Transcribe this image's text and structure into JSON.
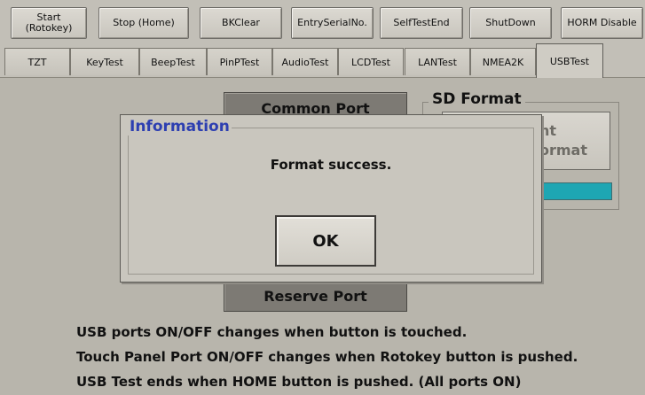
{
  "toolbar": {
    "buttons": [
      {
        "label": "Start\n(Rotokey)"
      },
      {
        "label": "Stop (Home)"
      },
      {
        "label": "BKClear"
      },
      {
        "label": "EntrySerialNo."
      },
      {
        "label": "SelfTestEnd"
      },
      {
        "label": "ShutDown"
      },
      {
        "label": "HORM Disable"
      }
    ]
  },
  "tabs": [
    {
      "label": "TZT"
    },
    {
      "label": "KeyTest"
    },
    {
      "label": "BeepTest"
    },
    {
      "label": "PinPTest"
    },
    {
      "label": "AudioTest"
    },
    {
      "label": "LCDTest"
    },
    {
      "label": "LANTest"
    },
    {
      "label": "NMEA2K"
    },
    {
      "label": "USBTest",
      "active": true
    }
  ],
  "main": {
    "common_port_label": "Common Port",
    "reserve_port_label": "Reserve Port",
    "sd_format": {
      "title": "SD Format",
      "button_label": "ht\normat",
      "progress_color": "#1ea6b3"
    },
    "notes": [
      "USB ports ON/OFF changes when button is touched.",
      "Touch Panel Port ON/OFF changes when Rotokey button is pushed.",
      "USB Test ends when HOME button is pushed. (All ports ON)"
    ]
  },
  "dialog": {
    "title": "Information",
    "message": "Format success.",
    "ok_label": "OK"
  },
  "colors": {
    "background": "#b8b5ac",
    "dialog_title": "#2d3fb1"
  }
}
